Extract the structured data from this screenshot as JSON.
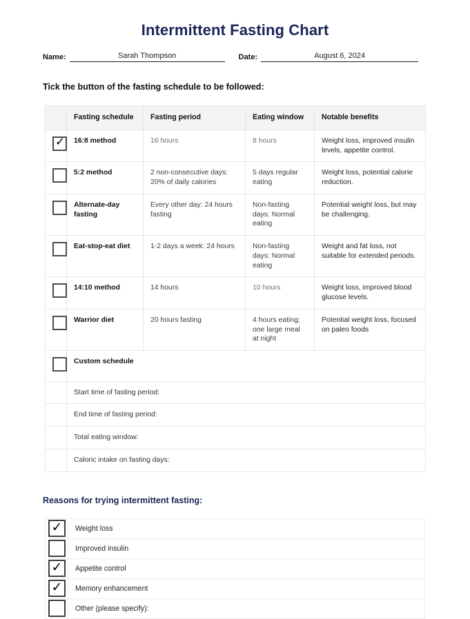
{
  "document": {
    "title": "Intermittent Fasting Chart",
    "title_color": "#1a2456"
  },
  "identity": {
    "name_label": "Name:",
    "name_value": "Sarah Thompson",
    "date_label": "Date:",
    "date_value": "August 6, 2024"
  },
  "schedule_section": {
    "instruction": "Tick the button of the fasting schedule to be followed:",
    "columns": {
      "checkbox": "",
      "schedule": "Fasting schedule",
      "period": "Fasting period",
      "eating": "Eating window",
      "benefits": "Notable benefits"
    },
    "rows": [
      {
        "checked": true,
        "check_glyph": "✓",
        "schedule": "16:8 method",
        "period": "16 hours",
        "eating": "8 hours",
        "benefits": "Weight loss, improved insulin levels, appetite control.",
        "muted": true
      },
      {
        "checked": false,
        "check_glyph": "",
        "schedule": "5:2 method",
        "period": "2 non-consecutive days: 20% of daily calories",
        "eating": "5 days regular eating",
        "benefits": "Weight loss, potential calorie reduction.",
        "muted": false
      },
      {
        "checked": false,
        "check_glyph": "",
        "schedule": "Alternate-day fasting",
        "period": "Every other day: 24 hours fasting",
        "eating": "Non-fasting days: Normal eating",
        "benefits": "Potential weight loss, but may be challenging.",
        "muted": false
      },
      {
        "checked": false,
        "check_glyph": "",
        "schedule": "Eat-stop-eat diet",
        "period": "1-2 days a week: 24 hours",
        "eating": "Non-fasting days: Normal eating",
        "benefits": "Weight and fat loss, not suitable for extended periods.",
        "muted": false
      },
      {
        "checked": false,
        "check_glyph": "",
        "schedule": "14:10 method",
        "period": "14 hours",
        "eating": "10 hours",
        "benefits": "Weight loss, improved blood glucose levels.",
        "muted": true
      },
      {
        "checked": false,
        "check_glyph": "",
        "schedule": "Warrior diet",
        "period": "20 hours fasting",
        "eating": "4 hours eating; one large meal at night",
        "benefits": "Potential weight loss, focused on paleo foods",
        "muted": false
      }
    ],
    "custom": {
      "checked": false,
      "check_glyph": "",
      "label": "Custom schedule",
      "fields": [
        "Start time of fasting period:",
        "End time of fasting period:",
        "Total eating window:",
        "Caloric intake on fasting days:"
      ]
    }
  },
  "reasons_section": {
    "heading": "Reasons for trying intermittent fasting:",
    "heading_color": "#1a2456",
    "items": [
      {
        "label": "Weight loss",
        "checked": true,
        "check_glyph": "✓"
      },
      {
        "label": "Improved insulin",
        "checked": false,
        "check_glyph": ""
      },
      {
        "label": "Appetite control",
        "checked": true,
        "check_glyph": "✓"
      },
      {
        "label": "Memory enhancement",
        "checked": true,
        "check_glyph": "✓"
      },
      {
        "label": "Other (please specify):",
        "checked": false,
        "check_glyph": ""
      }
    ]
  }
}
